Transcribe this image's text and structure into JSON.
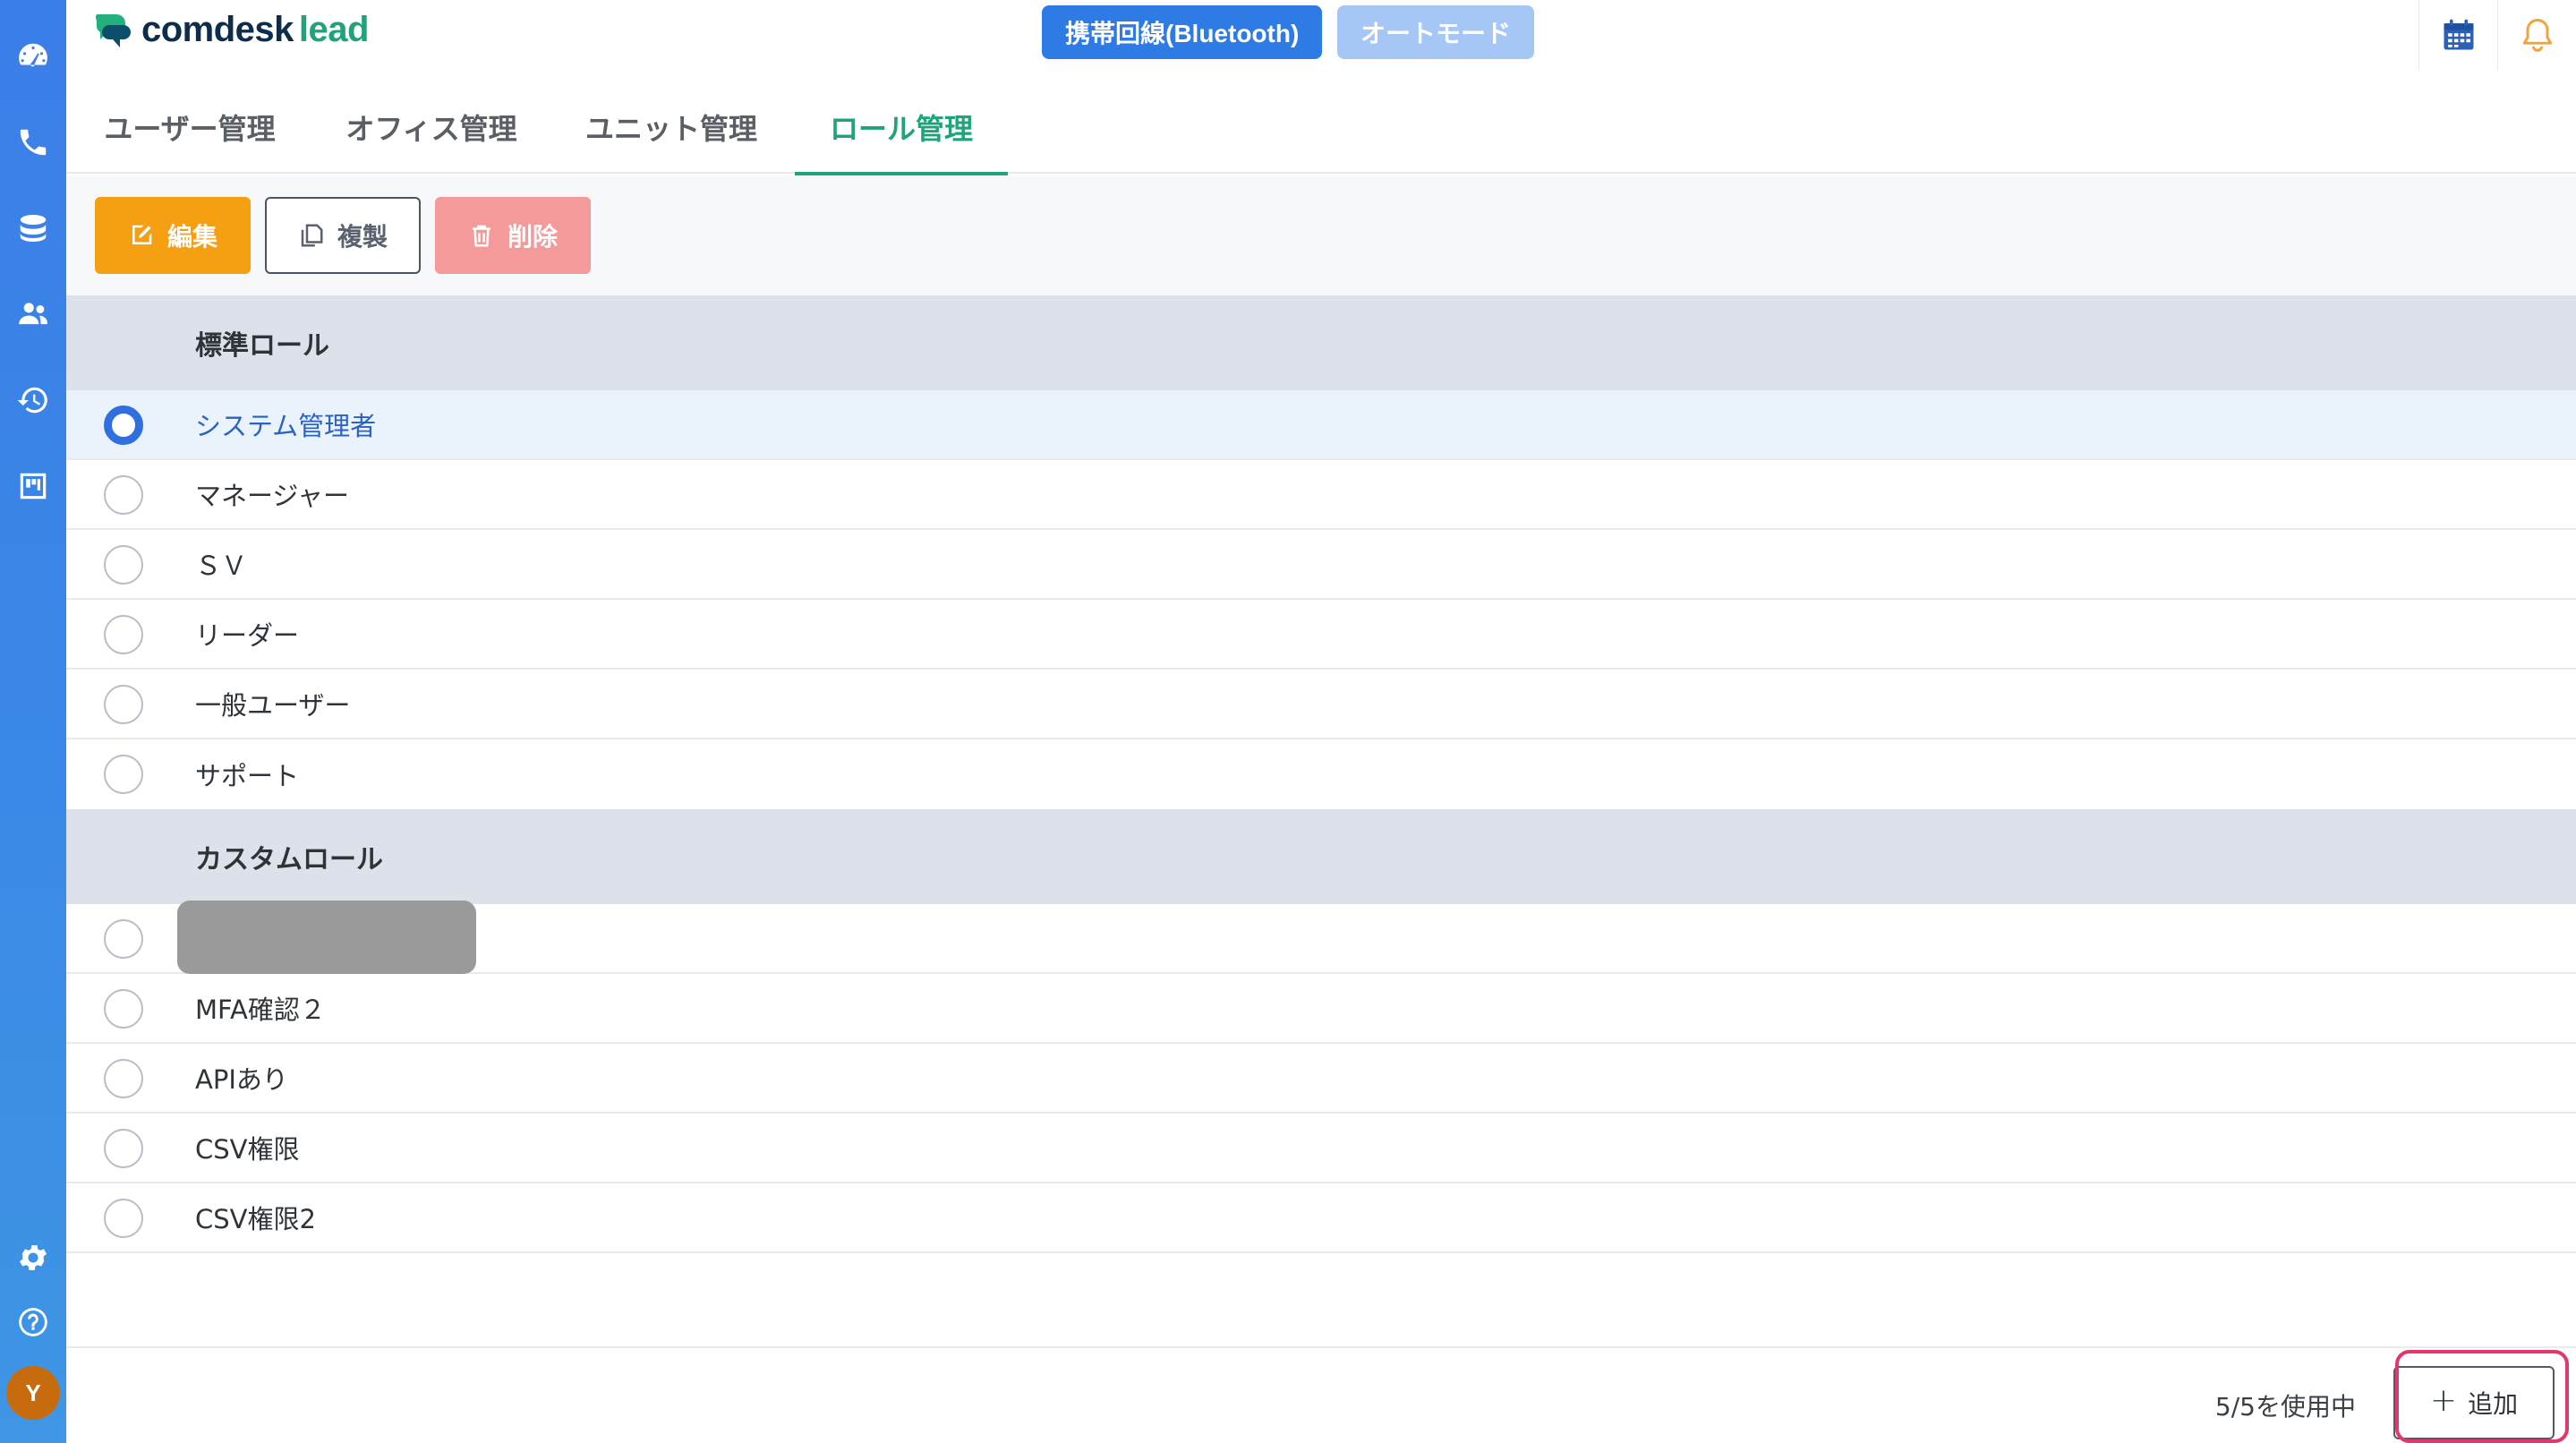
{
  "app": {
    "logo_text": "comdesk",
    "logo_text_accent": "lead"
  },
  "header": {
    "chip_bluetooth": "携帯回線(Bluetooth)",
    "chip_auto": "オートモード"
  },
  "tabs": [
    {
      "label": "ユーザー管理",
      "active": false
    },
    {
      "label": "オフィス管理",
      "active": false
    },
    {
      "label": "ユニット管理",
      "active": false
    },
    {
      "label": "ロール管理",
      "active": true
    }
  ],
  "toolbar": {
    "edit_label": "編集",
    "copy_label": "複製",
    "delete_label": "削除"
  },
  "sections": {
    "standard": {
      "title": "標準ロール",
      "items": [
        {
          "label": "システム管理者",
          "selected": true
        },
        {
          "label": "マネージャー",
          "selected": false
        },
        {
          "label": "ＳＶ",
          "selected": false
        },
        {
          "label": "リーダー",
          "selected": false
        },
        {
          "label": "一般ユーザー",
          "selected": false
        },
        {
          "label": "サポート",
          "selected": false
        }
      ]
    },
    "custom": {
      "title": "カスタムロール",
      "items": [
        {
          "label": "",
          "selected": false,
          "redacted": true
        },
        {
          "label": "MFA確認２",
          "selected": false
        },
        {
          "label": "APIあり",
          "selected": false
        },
        {
          "label": "CSV権限",
          "selected": false
        },
        {
          "label": "CSV権限2",
          "selected": false
        }
      ]
    }
  },
  "footer": {
    "usage": "5/5を使用中",
    "add_label": "追加"
  },
  "user": {
    "avatar_initial": "Y"
  },
  "colors": {
    "accent_green": "#1fa37a",
    "primary_blue": "#2f6fe0",
    "edit_orange": "#f59f12",
    "delete_pink": "#f59a9a",
    "highlight": "#e2376b"
  }
}
